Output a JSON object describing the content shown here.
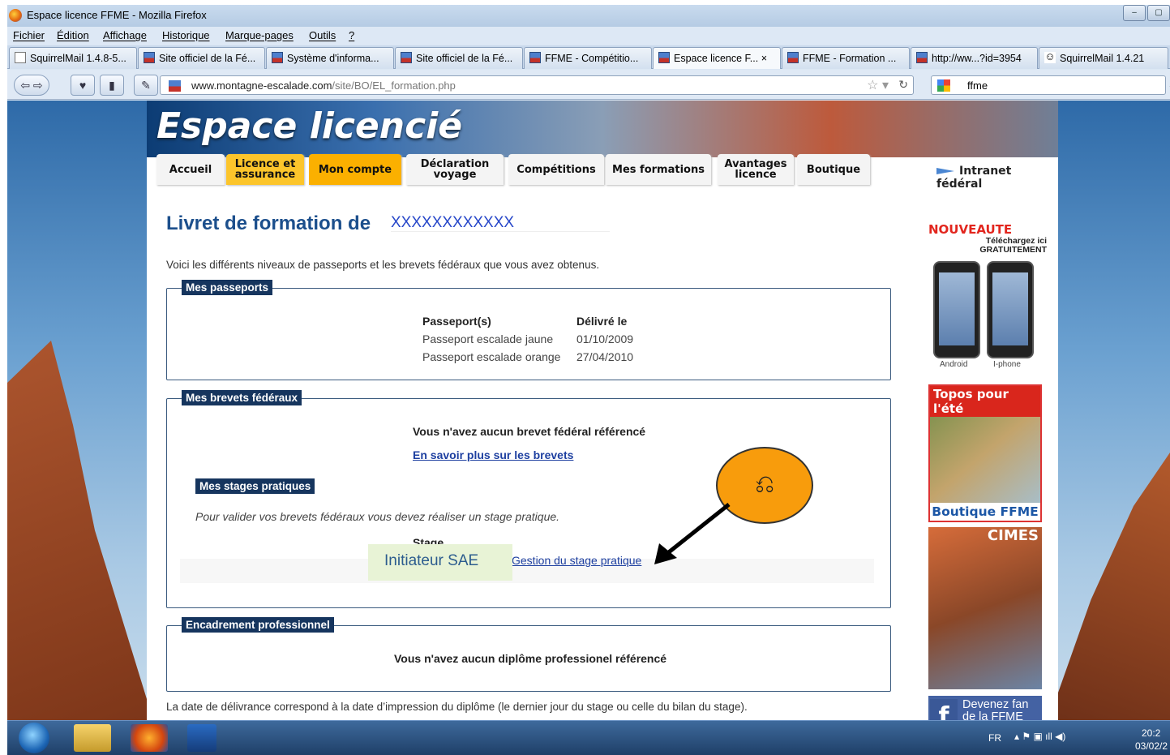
{
  "window": {
    "title": "Espace licence FFME - Mozilla Firefox"
  },
  "menu": [
    "Fichier",
    "Édition",
    "Affichage",
    "Historique",
    "Marque-pages",
    "Outils",
    "?"
  ],
  "tabs": [
    "SquirrelMail 1.4.8-5...",
    "Site officiel de la Fé...",
    "Système d'informa...",
    "Site officiel de la Fé...",
    "FFME - Compétitio...",
    "Espace licence F...",
    "FFME - Formation ...",
    "http://ww...?id=3954",
    "SquirrelMail 1.4.21"
  ],
  "tab_close": "×",
  "url": {
    "host": "www.montagne-escalade.com",
    "path": "/site/BO/EL_formation.php"
  },
  "search": {
    "value": "ffme"
  },
  "site": {
    "banner_title": "Espace licencié",
    "nav": [
      "Accueil",
      "Licence et assurance",
      "Mon compte",
      "Déclaration voyage",
      "Compétitions",
      "Mes formations",
      "Avantages licence",
      "Boutique"
    ],
    "intranet": "Intranet fédéral"
  },
  "content": {
    "heading": "Livret de formation de",
    "name": "XXXXXXXXXXXX",
    "intro": "Voici les différents niveaux de passeports et les brevets fédéraux que vous avez obtenus.",
    "passeports": {
      "legend": "Mes passeports",
      "col1": "Passeport(s)",
      "col2": "Délivré le",
      "rows": [
        {
          "name": "Passeport escalade jaune",
          "date": "01/10/2009"
        },
        {
          "name": "Passeport escalade orange",
          "date": "27/04/2010"
        }
      ]
    },
    "brevets": {
      "legend": "Mes brevets fédéraux",
      "none": "Vous n'avez aucun brevet fédéral référencé",
      "more_link": "En savoir plus sur les brevets",
      "stages_legend": "Mes stages pratiques",
      "stages_note": "Pour valider vos brevets fédéraux vous devez réaliser un stage pratique.",
      "stage_hdr": "Stage",
      "stage_name": "Initiateur SAE",
      "stage_link": "Gestion du stage pratique"
    },
    "encadrement": {
      "legend": "Encadrement professionnel",
      "none": "Vous n'avez aucun diplôme professionel référencé"
    },
    "footnote": "La date de délivrance correspond à la date d’impression du diplôme (le dernier jour du stage ou celle du bilan du stage)."
  },
  "sidebar": {
    "nouveaute": "NOUVEAUTE",
    "dl1": "Téléchargez ici",
    "dl2": "GRATUITEMENT",
    "android": "Android",
    "iphone": "I-phone",
    "topos": "Topos pour l'été",
    "boutique": "Boutique FFME",
    "cimes": "CIMES",
    "fan": "Devenez fan de la FFME"
  },
  "tray": {
    "lang": "FR",
    "time": "20:2",
    "date": "03/02/2"
  }
}
